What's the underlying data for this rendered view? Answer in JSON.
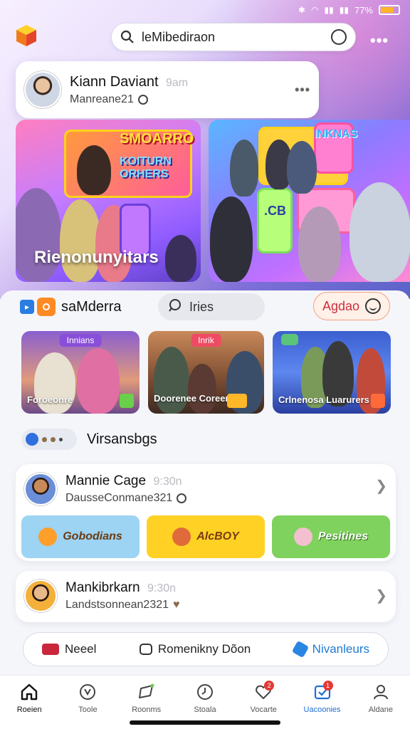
{
  "status_bar": {
    "battery": "77%"
  },
  "header": {
    "search_value": "leMibediraon"
  },
  "profile": {
    "name": "Kiann Daviant",
    "time": "9am",
    "subtitle": "Manreane21"
  },
  "hero": {
    "left_caption": "Rienonunyitars",
    "left_sign_1": "SMOARRO",
    "left_sign_2": "KOITURN ORHERS",
    "right_sign_1": "INKNAS",
    "right_sign_2": ".CB"
  },
  "section": {
    "title": "saMderra",
    "search_chip": "Iries",
    "action_chip": "Agdao"
  },
  "thumbnails": [
    {
      "tag": "Innians",
      "label": "Foroeonre"
    },
    {
      "tag": "Inrik",
      "label": "Doorenee Coreers"
    },
    {
      "tag": "",
      "label": "Crlnenosa Luarurers"
    }
  ],
  "section2": {
    "title": "Virsansbgs"
  },
  "cards": [
    {
      "name": "Mannie Cage",
      "time": "9:30n",
      "subtitle": "DausseConmane321",
      "stickers": [
        "Gobodians",
        "AlcBOY",
        "Pesitines"
      ]
    },
    {
      "name": "Mankibrkarn",
      "time": "9:30n",
      "subtitle": "Landstsonnean2321"
    }
  ],
  "actions": {
    "a1": "Neeel",
    "a2": "Romenikny Dõon",
    "a3": "Nivanleurs"
  },
  "nav": [
    {
      "label": "Roeien",
      "icon": "home-icon"
    },
    {
      "label": "Toole",
      "icon": "compass-icon"
    },
    {
      "label": "Roonms",
      "icon": "send-icon"
    },
    {
      "label": "Stoala",
      "icon": "clock-icon"
    },
    {
      "label": "Vocarte",
      "icon": "heart-icon",
      "badge": "2"
    },
    {
      "label": "Uacoonies",
      "icon": "inbox-icon",
      "badge": "1"
    },
    {
      "label": "Aldane",
      "icon": "user-icon"
    }
  ]
}
